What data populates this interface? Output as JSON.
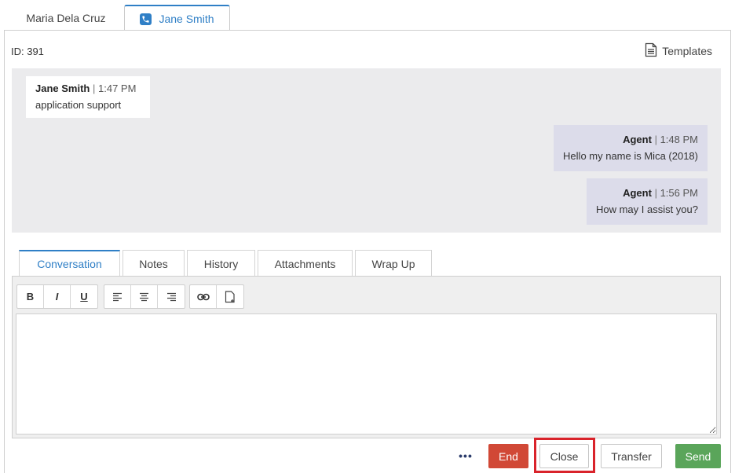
{
  "session_tabs": [
    {
      "label": "Maria Dela Cruz"
    },
    {
      "label": "Jane Smith",
      "icon": "phone-icon"
    }
  ],
  "header": {
    "id_label": "ID: 391",
    "templates_label": "Templates"
  },
  "messages": [
    {
      "sender": "Jane Smith",
      "separator": "|",
      "time": "1:47 PM",
      "text": "application support"
    },
    {
      "sender": "Agent",
      "separator": "|",
      "time": "1:48 PM",
      "text": "Hello my name is Mica (2018)"
    },
    {
      "sender": "Agent",
      "separator": "|",
      "time": "1:56 PM",
      "text": "How may I assist you?"
    }
  ],
  "sub_tabs": [
    {
      "label": "Conversation"
    },
    {
      "label": "Notes"
    },
    {
      "label": "History"
    },
    {
      "label": "Attachments"
    },
    {
      "label": "Wrap Up"
    }
  ],
  "toolbar": {
    "bold": "B",
    "italic": "I",
    "underline": "U"
  },
  "actions": {
    "more": "•••",
    "end": "End",
    "close": "Close",
    "transfer": "Transfer",
    "send": "Send"
  },
  "colors": {
    "accent": "#2f7fc6",
    "end": "#d14836",
    "send": "#5aa55a",
    "highlight": "#d9232b"
  }
}
